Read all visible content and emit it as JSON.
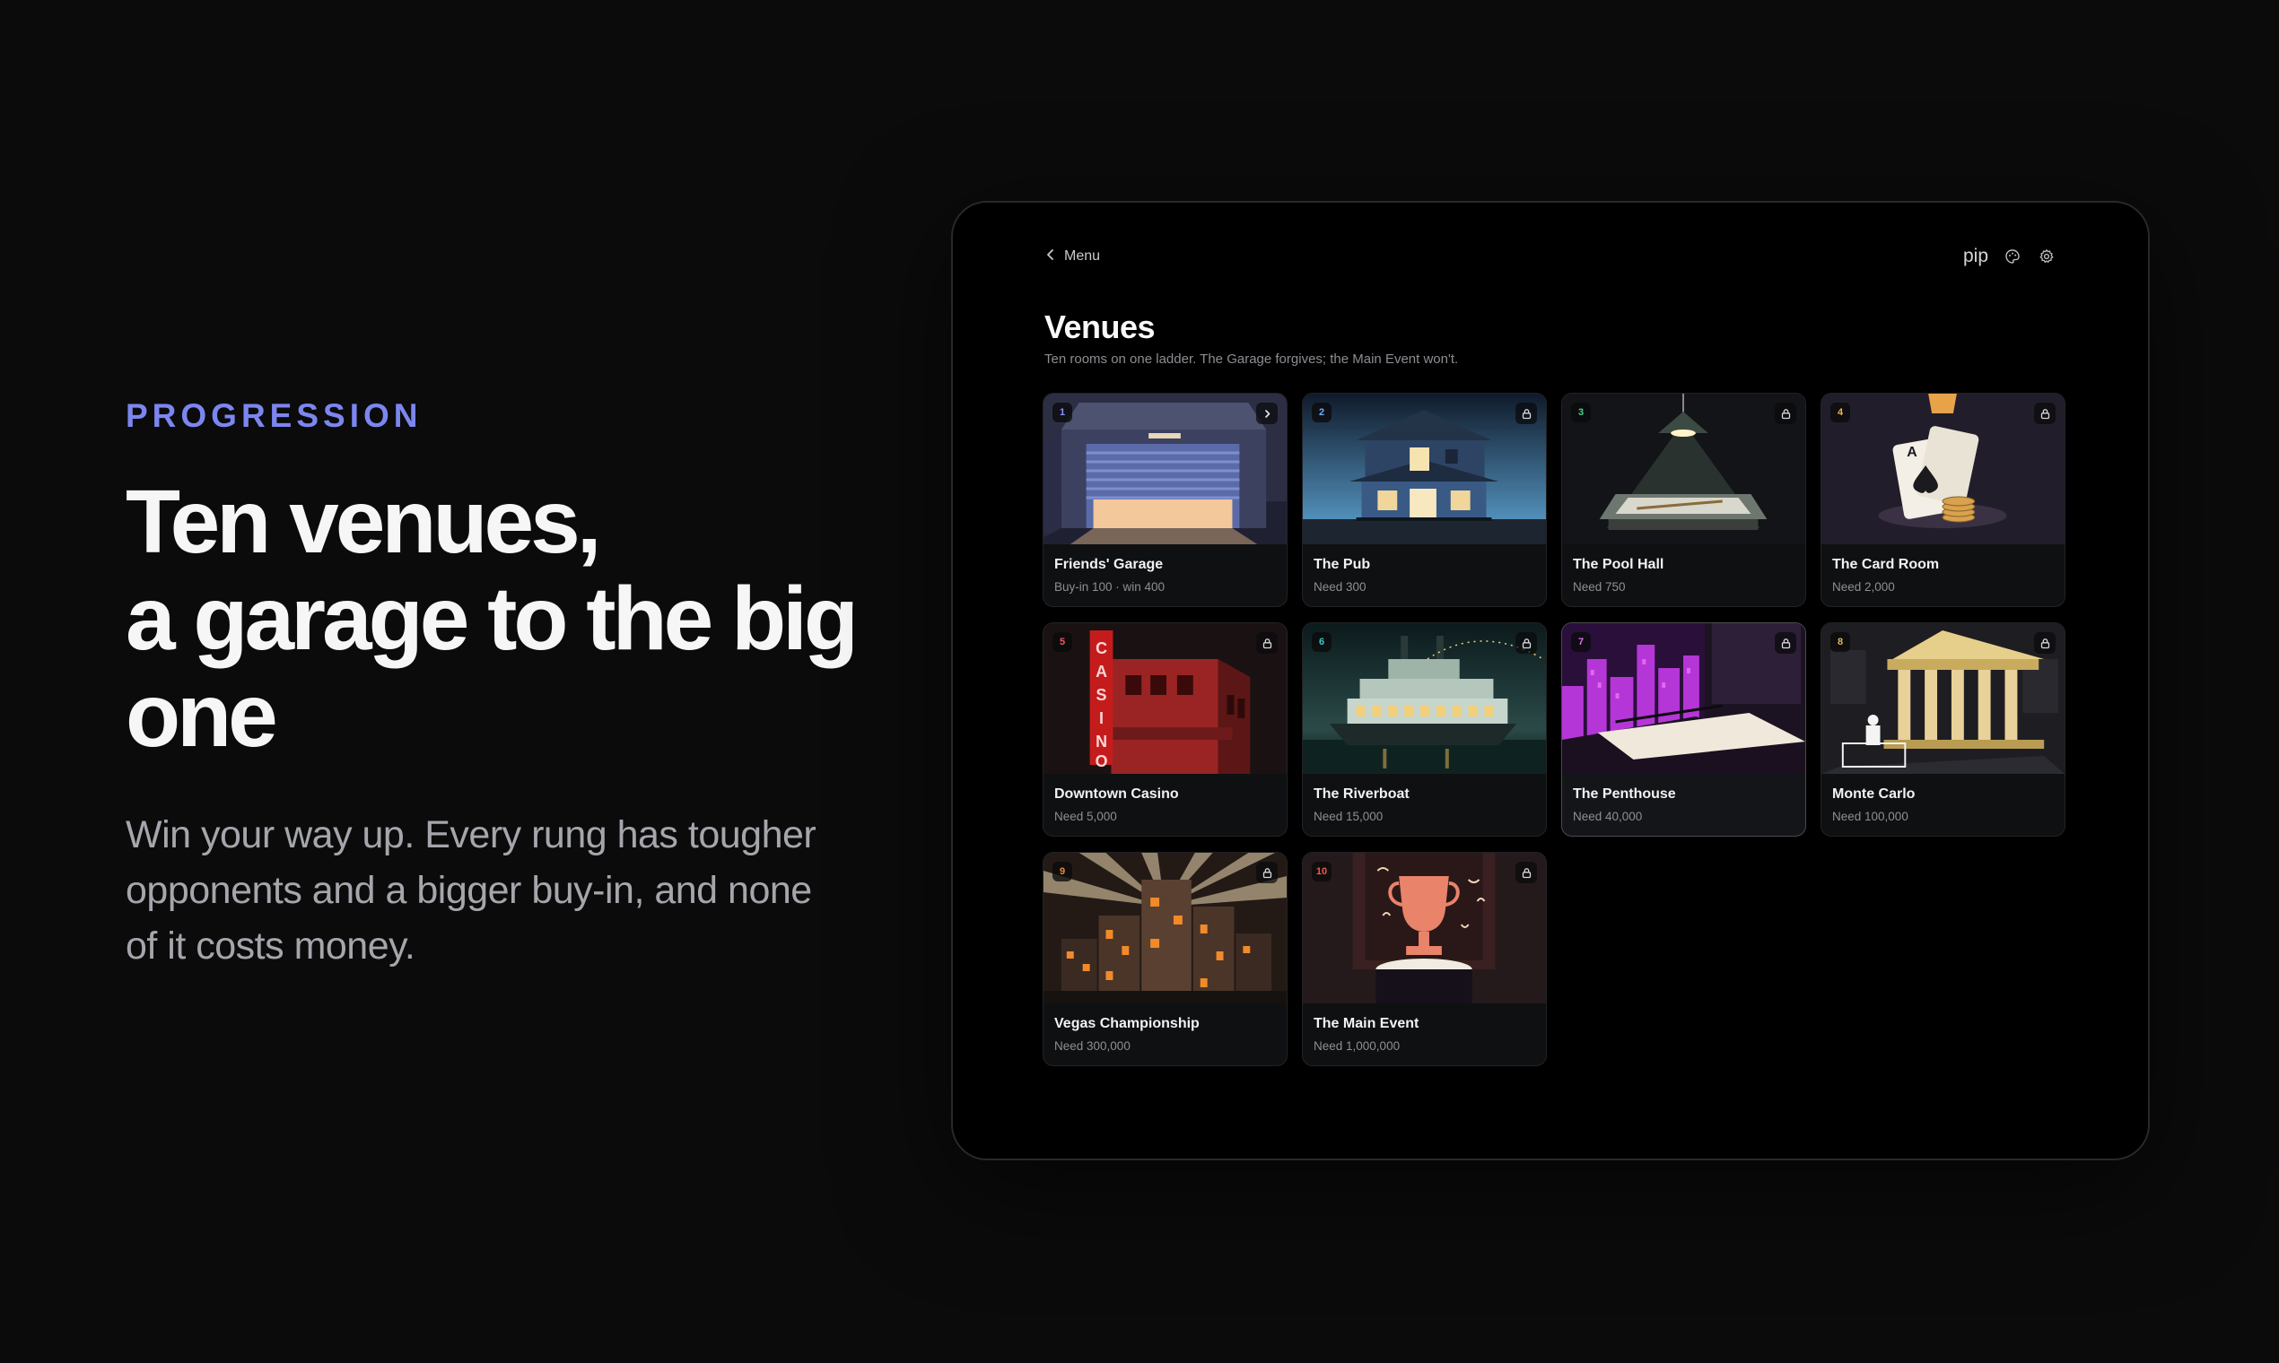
{
  "hero": {
    "eyebrow": "PROGRESSION",
    "headline_lines": [
      "Ten venues,",
      "a garage to the big",
      "one"
    ],
    "body": "Win your way up. Every rung has tougher opponents and a bigger buy-in, and none of it costs money."
  },
  "app": {
    "back_label": "Menu",
    "brand": "pip",
    "icons": {
      "back": "chevron-left-icon",
      "theme": "palette-icon",
      "settings": "gear-icon"
    },
    "title": "Venues",
    "subtitle": "Ten rooms on one ladder. The Garage forgives; the Main Event won't.",
    "venues": [
      {
        "num": "1",
        "name": "Friends' Garage",
        "req": "Buy-in 100 · win 400",
        "status": "open",
        "num_color": "#8a93ff"
      },
      {
        "num": "2",
        "name": "The Pub",
        "req": "Need 300",
        "status": "locked",
        "num_color": "#6fb0ff"
      },
      {
        "num": "3",
        "name": "The Pool Hall",
        "req": "Need 750",
        "status": "locked",
        "num_color": "#4fd08a"
      },
      {
        "num": "4",
        "name": "The Card Room",
        "req": "Need 2,000",
        "status": "locked",
        "num_color": "#f0b54a"
      },
      {
        "num": "5",
        "name": "Downtown Casino",
        "req": "Need 5,000",
        "status": "locked",
        "num_color": "#f0585a"
      },
      {
        "num": "6",
        "name": "The Riverboat",
        "req": "Need 15,000",
        "status": "locked",
        "num_color": "#3fc7c9"
      },
      {
        "num": "7",
        "name": "The Penthouse",
        "req": "Need 40,000",
        "status": "locked",
        "num_color": "#d870f0"
      },
      {
        "num": "8",
        "name": "Monte Carlo",
        "req": "Need 100,000",
        "status": "locked",
        "num_color": "#e0b85a"
      },
      {
        "num": "9",
        "name": "Vegas Championship",
        "req": "Need 300,000",
        "status": "locked",
        "num_color": "#f08a3a"
      },
      {
        "num": "10",
        "name": "The Main Event",
        "req": "Need 1,000,000",
        "status": "locked",
        "num_color": "#f05a4a"
      }
    ],
    "colors": {
      "accent": "#7c86ef",
      "background": "#0b0b0c",
      "card_border": "#222326",
      "hover_border": "#4a4b50"
    }
  }
}
